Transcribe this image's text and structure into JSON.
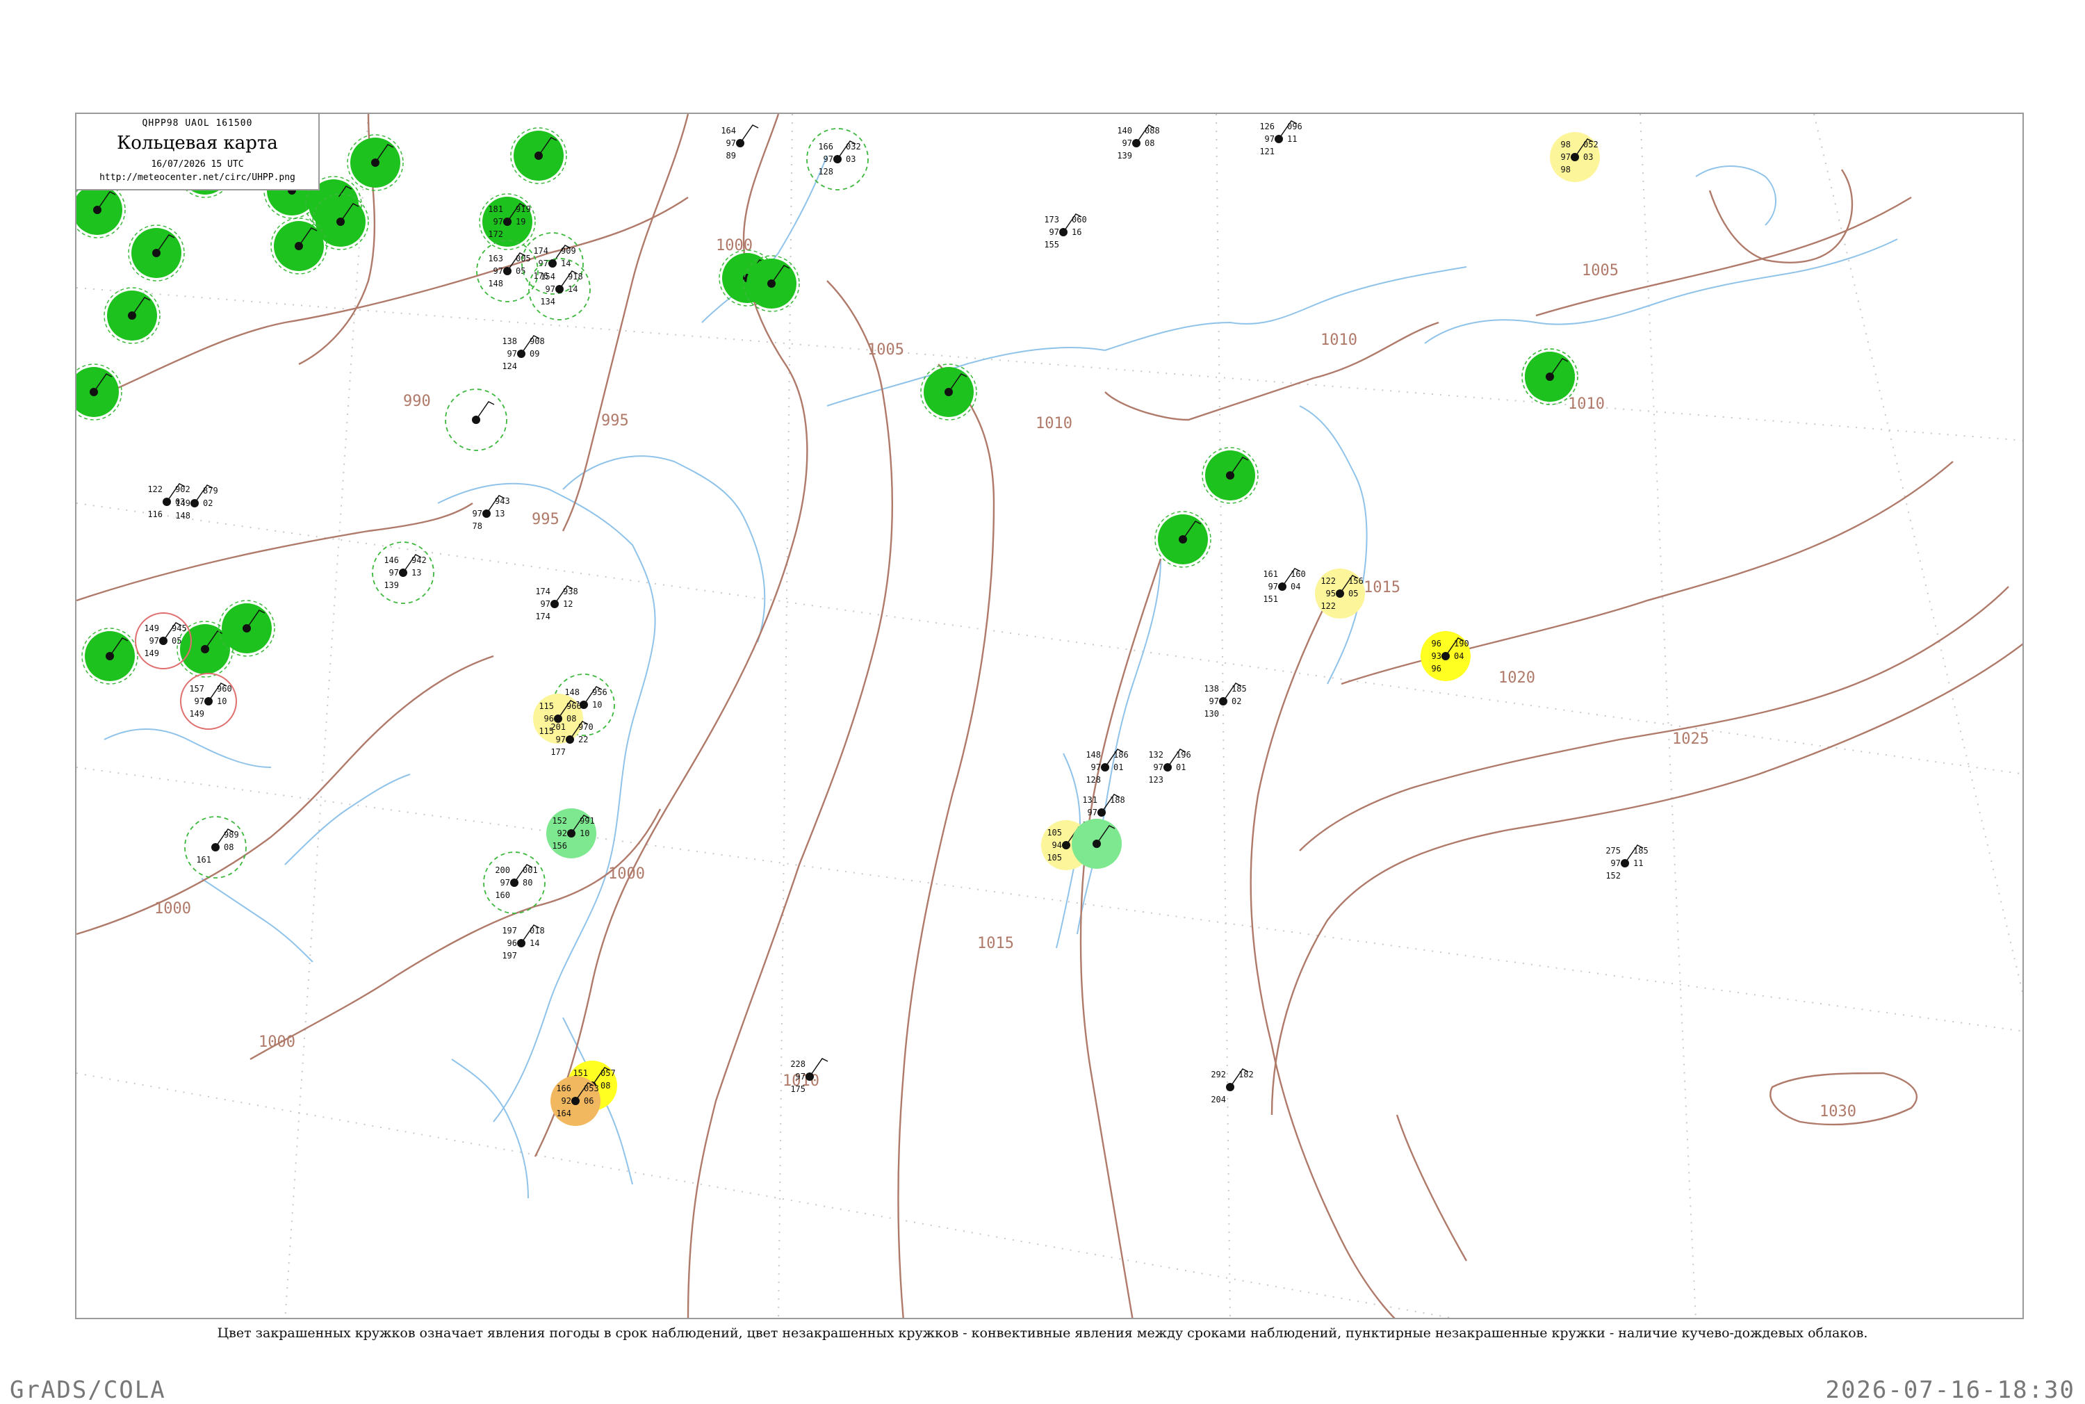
{
  "header": {
    "code_line": "QHPP98  UAOL  161500",
    "title": "Кольцевая карта",
    "date": "16/07/2026 15 UTC",
    "url": "http://meteocenter.net/circ/UHPP.png"
  },
  "caption": "Цвет закрашенных кружков означает явления погоды в срок наблюдений, цвет незакрашенных кружков - конвективные явления между сроками наблюдений, пунктирные незакрашенные кружки - наличие кучево-дождевых облаков.",
  "footer": {
    "left": "GrADS/COLA",
    "right": "2026-07-16-18:30"
  },
  "colors": {
    "isobar": "#b07a6a",
    "coast": "#8fc3ea",
    "green_fill": "#1ec21e",
    "light_green_fill": "#7ee890",
    "yellow_fill": "#ffff22",
    "pale_yellow_fill": "#fcf59a",
    "orange_fill": "#f2b860",
    "cb_ring": "#3cb83c",
    "red_ring": "#e07070"
  },
  "isobar_labels": [
    "990",
    "995",
    "995",
    "1000",
    "1000",
    "1000",
    "1000",
    "1005",
    "1005",
    "1010",
    "1010",
    "1010",
    "1010",
    "1015",
    "1015",
    "1020",
    "1025",
    "1030"
  ],
  "stations": [
    {
      "fill": "green",
      "top_left": "181",
      "top_right": "919",
      "mid_left": "97",
      "mid_right": "19",
      "bottom_left": "172",
      "name": ""
    },
    {
      "fill": "cb",
      "top_left": "163",
      "top_right": "005",
      "mid_left": "97",
      "mid_right": "05",
      "bottom_left": "148",
      "name": ""
    },
    {
      "fill": "cb",
      "top_left": "174",
      "top_right": "909",
      "mid_left": "97",
      "mid_right": "14",
      "bottom_left": "176",
      "name": ""
    },
    {
      "fill": "cb",
      "top_left": "154",
      "top_right": "918",
      "mid_left": "97",
      "mid_right": "14",
      "bottom_left": "134",
      "name": ""
    },
    {
      "fill": "none",
      "top_left": "138",
      "top_right": "908",
      "mid_left": "97",
      "mid_right": "09",
      "bottom_left": "124",
      "name": ""
    },
    {
      "fill": "none",
      "top_left": "164",
      "top_right": "",
      "mid_left": "97",
      "mid_right": "",
      "bottom_left": "89",
      "name": ""
    },
    {
      "fill": "cb",
      "top_left": "166",
      "top_right": "032",
      "mid_left": "97",
      "mid_right": "03",
      "bottom_left": "128",
      "name": ""
    },
    {
      "fill": "none",
      "top_left": "140",
      "top_right": "088",
      "mid_left": "97",
      "mid_right": "08",
      "bottom_left": "139",
      "name": ""
    },
    {
      "fill": "none",
      "top_left": "126",
      "top_right": "096",
      "mid_left": "97",
      "mid_right": "11",
      "bottom_left": "121",
      "name": ""
    },
    {
      "fill": "none",
      "top_left": "173",
      "top_right": "060",
      "mid_left": "97",
      "mid_right": "16",
      "bottom_left": "155",
      "name": ""
    },
    {
      "fill": "pale-yellow",
      "top_left": "98",
      "top_right": "052",
      "mid_left": "97",
      "mid_right": "03",
      "bottom_left": "98",
      "name": ""
    },
    {
      "fill": "green",
      "top_left": "",
      "top_right": "",
      "mid_left": "",
      "mid_right": "",
      "bottom_left": "",
      "name": ""
    },
    {
      "fill": "green",
      "top_left": "",
      "top_right": "",
      "mid_left": "",
      "mid_right": "",
      "bottom_left": "",
      "name": ""
    },
    {
      "fill": "none",
      "top_left": "122",
      "top_right": "902",
      "mid_left": "",
      "mid_right": "03",
      "bottom_left": "116",
      "name": ""
    },
    {
      "fill": "none",
      "top_left": "",
      "top_right": "879",
      "mid_left": "149",
      "mid_right": "02",
      "bottom_left": "148",
      "name": ""
    },
    {
      "fill": "none",
      "top_left": "",
      "top_right": "943",
      "mid_left": "97",
      "mid_right": "13",
      "bottom_left": "78",
      "name": ""
    },
    {
      "fill": "cb",
      "top_left": "146",
      "top_right": "942",
      "mid_left": "97",
      "mid_right": "13",
      "bottom_left": "139",
      "name": ""
    },
    {
      "fill": "none",
      "top_left": "174",
      "top_right": "938",
      "mid_left": "97",
      "mid_right": "12",
      "bottom_left": "174",
      "name": ""
    },
    {
      "fill": "cb",
      "top_left": "148",
      "top_right": "956",
      "mid_left": "97",
      "mid_right": "10",
      "bottom_left": "163",
      "name": ""
    },
    {
      "fill": "pale-yellow",
      "top_left": "115",
      "top_right": "966",
      "mid_left": "96",
      "mid_right": "08",
      "bottom_left": "115",
      "name": ""
    },
    {
      "fill": "none",
      "top_left": "201",
      "top_right": "970",
      "mid_left": "97",
      "mid_right": "22",
      "bottom_left": "177",
      "name": ""
    },
    {
      "fill": "light-green",
      "top_left": "152",
      "top_right": "991",
      "mid_left": "92",
      "mid_right": "10",
      "bottom_left": "156",
      "name": ""
    },
    {
      "fill": "cb",
      "top_left": "200",
      "top_right": "001",
      "mid_left": "97",
      "mid_right": "80",
      "bottom_left": "160",
      "name": ""
    },
    {
      "fill": "none",
      "top_left": "197",
      "top_right": "018",
      "mid_left": "96",
      "mid_right": "14",
      "bottom_left": "197",
      "name": ""
    },
    {
      "fill": "yellow",
      "top_left": "151",
      "top_right": "057",
      "mid_left": "92",
      "mid_right": "08",
      "bottom_left": "153",
      "name": ""
    },
    {
      "fill": "orange",
      "top_left": "166",
      "top_right": "053",
      "mid_left": "92",
      "mid_right": "06",
      "bottom_left": "164",
      "name": ""
    },
    {
      "fill": "none",
      "top_left": "228",
      "top_right": "",
      "mid_left": "97",
      "mid_right": "",
      "bottom_left": "175",
      "name": ""
    },
    {
      "fill": "none",
      "top_left": "148",
      "top_right": "186",
      "mid_left": "97",
      "mid_right": "01",
      "bottom_left": "128",
      "name": ""
    },
    {
      "fill": "none",
      "top_left": "132",
      "top_right": "196",
      "mid_left": "97",
      "mid_right": "01",
      "bottom_left": "123",
      "name": ""
    },
    {
      "fill": "none",
      "top_left": "131",
      "top_right": "188",
      "mid_left": "97",
      "mid_right": "",
      "bottom_left": "113",
      "name": ""
    },
    {
      "fill": "pale-yellow",
      "top_left": "105",
      "top_right": "",
      "mid_left": "94",
      "mid_right": "",
      "bottom_left": "105",
      "name": ""
    },
    {
      "fill": "light-green",
      "top_left": "",
      "top_right": "",
      "mid_left": "",
      "mid_right": "",
      "bottom_left": "",
      "name": ""
    },
    {
      "fill": "none",
      "top_left": "161",
      "top_right": "160",
      "mid_left": "97",
      "mid_right": "04",
      "bottom_left": "151",
      "name": ""
    },
    {
      "fill": "pale-yellow",
      "top_left": "122",
      "top_right": "156",
      "mid_left": "95",
      "mid_right": "05",
      "bottom_left": "122",
      "name": ""
    },
    {
      "fill": "yellow",
      "top_left": "96",
      "top_right": "190",
      "mid_left": "93",
      "mid_right": "04",
      "bottom_left": "96",
      "name": ""
    },
    {
      "fill": "none",
      "top_left": "138",
      "top_right": "185",
      "mid_left": "97",
      "mid_right": "02",
      "bottom_left": "130",
      "name": ""
    },
    {
      "fill": "none",
      "top_left": "275",
      "top_right": "185",
      "mid_left": "97",
      "mid_right": "11",
      "bottom_left": "152",
      "name": ""
    },
    {
      "fill": "none",
      "top_left": "292",
      "top_right": "182",
      "mid_left": "",
      "mid_right": "",
      "bottom_left": "204",
      "name": ""
    },
    {
      "fill": "green",
      "top_left": "",
      "top_right": "",
      "mid_left": "",
      "mid_right": "",
      "bottom_left": "",
      "name": ""
    },
    {
      "fill": "green",
      "top_left": "",
      "top_right": "",
      "mid_left": "",
      "mid_right": "",
      "bottom_left": "",
      "name": ""
    },
    {
      "fill": "green",
      "top_left": "",
      "top_right": "",
      "mid_left": "",
      "mid_right": "",
      "bottom_left": "",
      "name": ""
    },
    {
      "fill": "green",
      "top_left": "",
      "top_right": "",
      "mid_left": "",
      "mid_right": "",
      "bottom_left": "",
      "name": ""
    },
    {
      "fill": "green",
      "top_left": "",
      "top_right": "",
      "mid_left": "",
      "mid_right": "",
      "bottom_left": "",
      "name": ""
    },
    {
      "fill": "green",
      "top_left": "",
      "top_right": "",
      "mid_left": "",
      "mid_right": "",
      "bottom_left": "",
      "name": ""
    },
    {
      "fill": "green",
      "top_left": "",
      "top_right": "",
      "mid_left": "",
      "mid_right": "",
      "bottom_left": "",
      "name": ""
    },
    {
      "fill": "green",
      "top_left": "",
      "top_right": "",
      "mid_left": "",
      "mid_right": "",
      "bottom_left": "",
      "name": ""
    },
    {
      "fill": "green",
      "top_left": "",
      "top_right": "",
      "mid_left": "",
      "mid_right": "",
      "bottom_left": "",
      "name": ""
    },
    {
      "fill": "green",
      "top_left": "",
      "top_right": "",
      "mid_left": "",
      "mid_right": "",
      "bottom_left": "",
      "name": ""
    },
    {
      "fill": "green",
      "top_left": "",
      "top_right": "",
      "mid_left": "",
      "mid_right": "",
      "bottom_left": "",
      "name": ""
    },
    {
      "fill": "green",
      "top_left": "",
      "top_right": "",
      "mid_left": "",
      "mid_right": "",
      "bottom_left": "",
      "name": ""
    },
    {
      "fill": "green",
      "top_left": "",
      "top_right": "",
      "mid_left": "",
      "mid_right": "",
      "bottom_left": "",
      "name": ""
    },
    {
      "fill": "green",
      "top_left": "",
      "top_right": "",
      "mid_left": "",
      "mid_right": "",
      "bottom_left": "",
      "name": ""
    },
    {
      "fill": "green",
      "top_left": "",
      "top_right": "",
      "mid_left": "",
      "mid_right": "",
      "bottom_left": "",
      "name": ""
    },
    {
      "fill": "green",
      "top_left": "",
      "top_right": "",
      "mid_left": "",
      "mid_right": "",
      "bottom_left": "",
      "name": ""
    },
    {
      "fill": "green",
      "top_left": "",
      "top_right": "",
      "mid_left": "",
      "mid_right": "",
      "bottom_left": "",
      "name": ""
    },
    {
      "fill": "green",
      "top_left": "",
      "top_right": "",
      "mid_left": "",
      "mid_right": "",
      "bottom_left": "",
      "name": ""
    },
    {
      "fill": "green",
      "top_left": "",
      "top_right": "",
      "mid_left": "",
      "mid_right": "",
      "bottom_left": "",
      "name": ""
    },
    {
      "fill": "cb",
      "top_left": "",
      "top_right": "",
      "mid_left": "",
      "mid_right": "",
      "bottom_left": "",
      "name": ""
    },
    {
      "fill": "red",
      "top_left": "149",
      "top_right": "945",
      "mid_left": "97",
      "mid_right": "05",
      "bottom_left": "149",
      "name": ""
    },
    {
      "fill": "red",
      "top_left": "157",
      "top_right": "960",
      "mid_left": "97",
      "mid_right": "10",
      "bottom_left": "149",
      "name": ""
    },
    {
      "fill": "cb",
      "top_left": "",
      "top_right": "989",
      "mid_left": "",
      "mid_right": "08",
      "bottom_left": "161",
      "name": ""
    }
  ]
}
